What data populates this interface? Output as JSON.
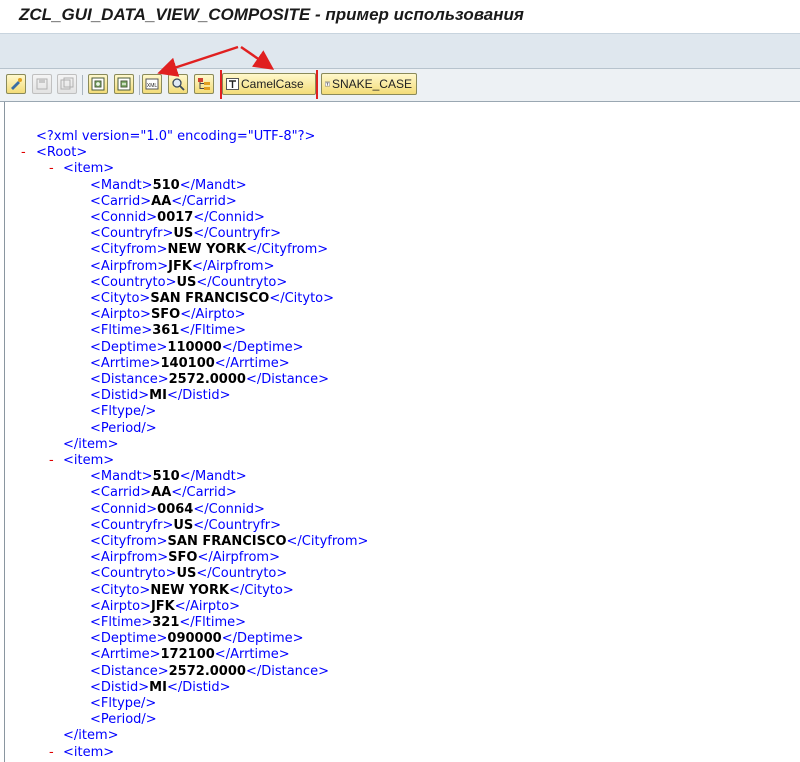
{
  "window": {
    "title": "ZCL_GUI_DATA_VIEW_COMPOSITE - пример использования"
  },
  "toolbar": {
    "icons": [
      {
        "name": "view-icon",
        "enabled": true
      },
      {
        "name": "save-icon",
        "enabled": false
      },
      {
        "name": "save-as-icon",
        "enabled": false
      },
      {
        "name": "expand-icon",
        "enabled": true
      },
      {
        "name": "collapse-icon",
        "enabled": true
      },
      {
        "name": "xml-icon",
        "enabled": true
      },
      {
        "name": "find-icon",
        "enabled": true
      },
      {
        "name": "tree-icon",
        "enabled": true
      }
    ],
    "camelcase_label": "CamelCase",
    "snakecase_label": "SNAKE_CASE"
  },
  "xml": {
    "declaration": "<?xml version=\"1.0\" encoding=\"UTF-8\"?>",
    "root_tag": "Root",
    "item_tag": "item",
    "collapse_marker": "-",
    "items": [
      {
        "fields": [
          {
            "tag": "Mandt",
            "value": "510"
          },
          {
            "tag": "Carrid",
            "value": "AA"
          },
          {
            "tag": "Connid",
            "value": "0017"
          },
          {
            "tag": "Countryfr",
            "value": "US"
          },
          {
            "tag": "Cityfrom",
            "value": "NEW YORK"
          },
          {
            "tag": "Airpfrom",
            "value": "JFK"
          },
          {
            "tag": "Countryto",
            "value": "US"
          },
          {
            "tag": "Cityto",
            "value": "SAN FRANCISCO"
          },
          {
            "tag": "Airpto",
            "value": "SFO"
          },
          {
            "tag": "Fltime",
            "value": "361"
          },
          {
            "tag": "Deptime",
            "value": "110000"
          },
          {
            "tag": "Arrtime",
            "value": "140100"
          },
          {
            "tag": "Distance",
            "value": "2572.0000"
          },
          {
            "tag": "Distid",
            "value": "MI"
          },
          {
            "tag": "Fltype",
            "value": ""
          },
          {
            "tag": "Period",
            "value": ""
          }
        ]
      },
      {
        "fields": [
          {
            "tag": "Mandt",
            "value": "510"
          },
          {
            "tag": "Carrid",
            "value": "AA"
          },
          {
            "tag": "Connid",
            "value": "0064"
          },
          {
            "tag": "Countryfr",
            "value": "US"
          },
          {
            "tag": "Cityfrom",
            "value": "SAN FRANCISCO"
          },
          {
            "tag": "Airpfrom",
            "value": "SFO"
          },
          {
            "tag": "Countryto",
            "value": "US"
          },
          {
            "tag": "Cityto",
            "value": "NEW YORK"
          },
          {
            "tag": "Airpto",
            "value": "JFK"
          },
          {
            "tag": "Fltime",
            "value": "321"
          },
          {
            "tag": "Deptime",
            "value": "090000"
          },
          {
            "tag": "Arrtime",
            "value": "172100"
          },
          {
            "tag": "Distance",
            "value": "2572.0000"
          },
          {
            "tag": "Distid",
            "value": "MI"
          },
          {
            "tag": "Fltype",
            "value": ""
          },
          {
            "tag": "Period",
            "value": ""
          }
        ]
      },
      {
        "fields": []
      }
    ]
  },
  "colors": {
    "tag": "#0000ff",
    "value": "#000000",
    "collapse_marker": "#e00000",
    "annotation": "#e02020"
  }
}
